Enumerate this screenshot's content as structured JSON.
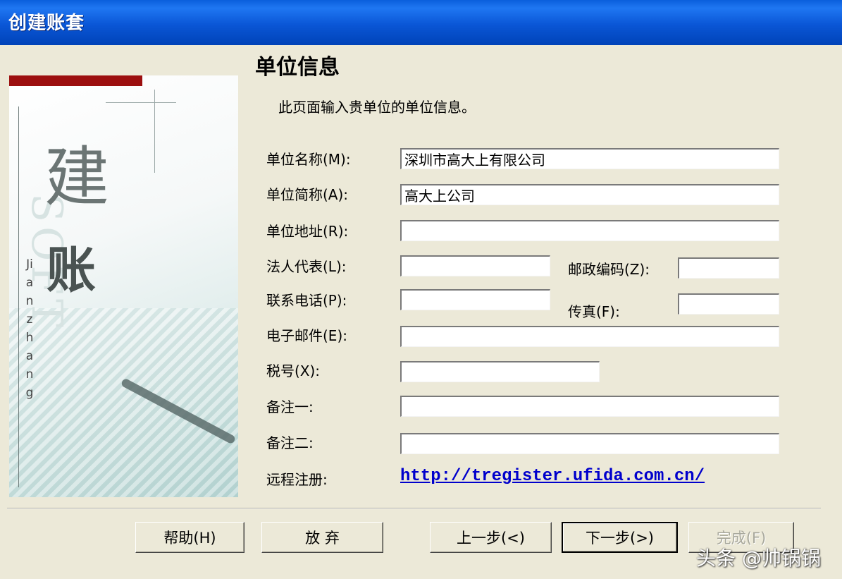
{
  "window": {
    "title": "创建账套"
  },
  "banner": {
    "jian": "建",
    "zhang": "账",
    "pinyin": "Jianzhang",
    "watermark_text": "SOFT"
  },
  "page": {
    "title": "单位信息",
    "description": "此页面输入贵单位的单位信息。"
  },
  "form": {
    "unit_name": {
      "label": "单位名称(M):",
      "value": "深圳市高大上有限公司"
    },
    "unit_abbr": {
      "label": "单位简称(A):",
      "value": "高大上公司"
    },
    "unit_address": {
      "label": "单位地址(R):",
      "value": ""
    },
    "legal_rep": {
      "label": "法人代表(L):",
      "value": ""
    },
    "postal_code": {
      "label": "邮政编码(Z):",
      "value": ""
    },
    "phone": {
      "label": "联系电话(P):",
      "value": ""
    },
    "fax": {
      "label": "传真(F):",
      "value": ""
    },
    "email": {
      "label": "电子邮件(E):",
      "value": ""
    },
    "tax_id": {
      "label": "税号(X):",
      "value": ""
    },
    "remark1": {
      "label": "备注一:",
      "value": ""
    },
    "remark2": {
      "label": "备注二:",
      "value": ""
    },
    "remote_register": {
      "label": "远程注册:",
      "link": "http://tregister.ufida.com.cn/"
    }
  },
  "buttons": {
    "help": "帮助(H)",
    "abandon": "放 弃",
    "prev": "上一步(<)",
    "next": "下一步(>)",
    "finish": "完成(F)"
  },
  "overlay": {
    "watermark": "头条 @帅锅锅"
  }
}
